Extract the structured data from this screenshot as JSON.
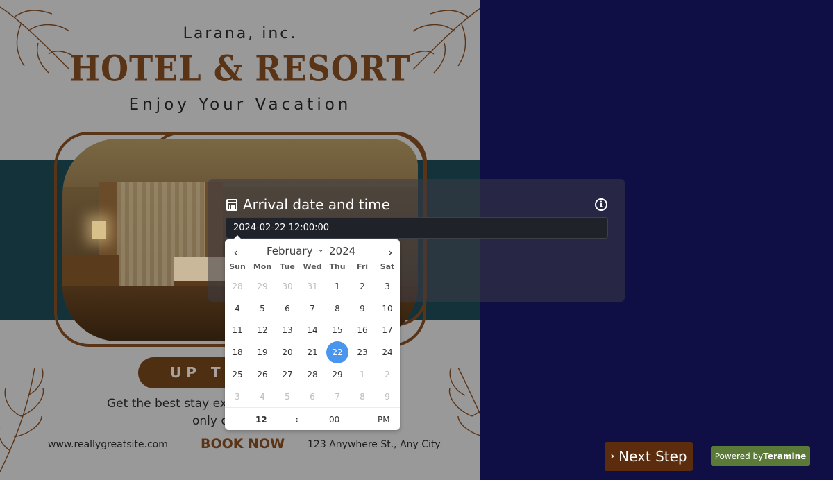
{
  "poster": {
    "brand": "Larana, inc.",
    "headline": "HOTEL & RESORT",
    "tagline": "Enjoy Your Vacation",
    "promo_pill": "UP TO",
    "promo_line1": "Get the best stay ex",
    "promo_line2": "only o",
    "website": "www.reallygreatsite.com",
    "cta": "BOOK NOW",
    "address": "123 Anywhere St., Any City"
  },
  "question": {
    "title": "Arrival date and time",
    "icon": "calendar-icon",
    "info_icon": "info-icon",
    "value": "2024-02-22 12:00:00"
  },
  "datepicker": {
    "prev_label": "‹",
    "next_label": "›",
    "month": "February",
    "year": "2024",
    "weekdays": [
      "Sun",
      "Mon",
      "Tue",
      "Wed",
      "Thu",
      "Fri",
      "Sat"
    ],
    "days": [
      {
        "d": "28",
        "muted": true
      },
      {
        "d": "29",
        "muted": true
      },
      {
        "d": "30",
        "muted": true
      },
      {
        "d": "31",
        "muted": true
      },
      {
        "d": "1"
      },
      {
        "d": "2"
      },
      {
        "d": "3"
      },
      {
        "d": "4"
      },
      {
        "d": "5"
      },
      {
        "d": "6"
      },
      {
        "d": "7"
      },
      {
        "d": "8"
      },
      {
        "d": "9"
      },
      {
        "d": "10"
      },
      {
        "d": "11"
      },
      {
        "d": "12"
      },
      {
        "d": "13"
      },
      {
        "d": "14"
      },
      {
        "d": "15"
      },
      {
        "d": "16"
      },
      {
        "d": "17"
      },
      {
        "d": "18"
      },
      {
        "d": "19"
      },
      {
        "d": "20"
      },
      {
        "d": "21"
      },
      {
        "d": "22",
        "selected": true
      },
      {
        "d": "23"
      },
      {
        "d": "24"
      },
      {
        "d": "25"
      },
      {
        "d": "26"
      },
      {
        "d": "27"
      },
      {
        "d": "28"
      },
      {
        "d": "29"
      },
      {
        "d": "1",
        "muted": true
      },
      {
        "d": "2",
        "muted": true
      },
      {
        "d": "3",
        "muted": true
      },
      {
        "d": "4",
        "muted": true
      },
      {
        "d": "5",
        "muted": true
      },
      {
        "d": "6",
        "muted": true
      },
      {
        "d": "7",
        "muted": true
      },
      {
        "d": "8",
        "muted": true
      },
      {
        "d": "9",
        "muted": true
      }
    ],
    "time": {
      "hour": "12",
      "separator": ":",
      "minute": "00",
      "ampm": "PM"
    },
    "selected_color": "#4a96ee"
  },
  "footer": {
    "next_label": "Next Step",
    "powered_prefix": "Powered by",
    "powered_brand": "Teramine",
    "next_color": "#5b2d0e",
    "powered_color": "#5b7a37"
  }
}
